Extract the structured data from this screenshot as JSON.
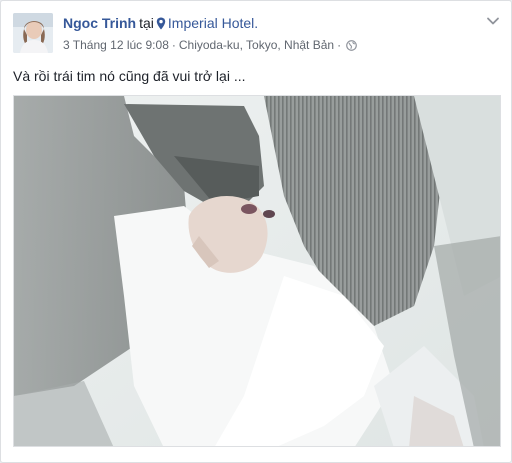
{
  "post": {
    "author_name": "Ngoc Trinh",
    "tagged_preposition": "tại",
    "location_name": "Imperial Hotel.",
    "timestamp": "3 Tháng 12 lúc 9:08",
    "place_detail": "Chiyoda-ku, Tokyo, Nhật Bản",
    "separator": "·",
    "caption": "Và rồi trái tim nó cũng đã vui trở lại ...",
    "icons": {
      "location": "map-pin-icon",
      "privacy": "globe-icon",
      "options": "chevron-down-icon"
    },
    "colors": {
      "link": "#365899",
      "meta_text": "#616770",
      "body_text": "#1d2129"
    }
  }
}
